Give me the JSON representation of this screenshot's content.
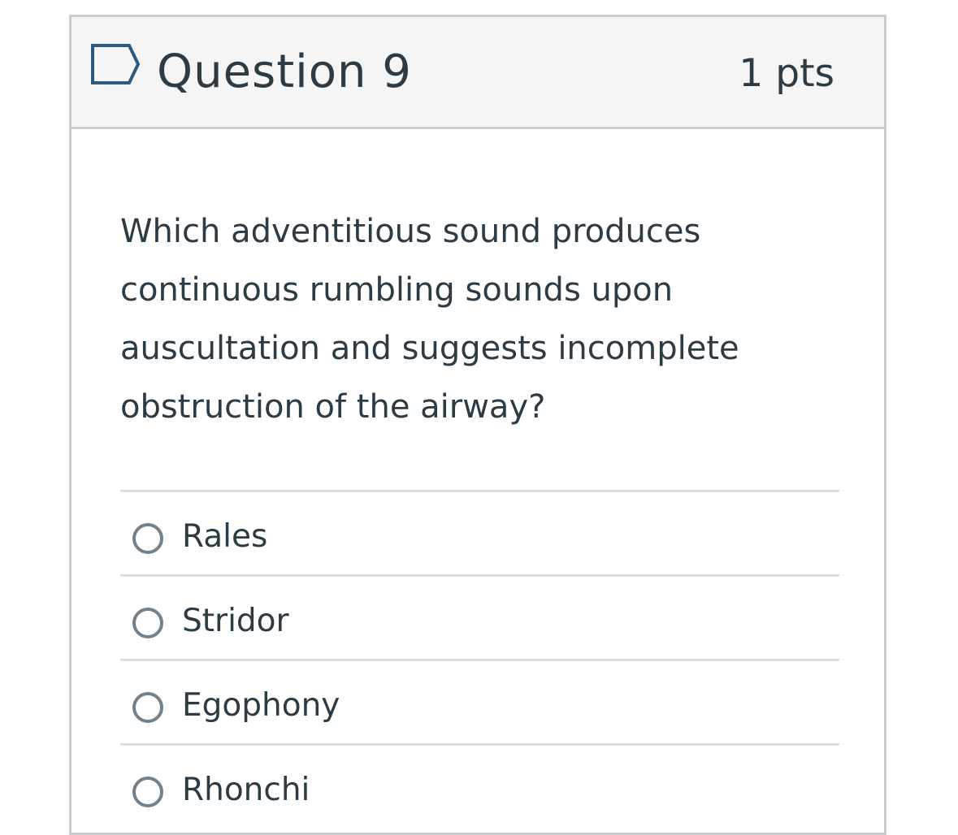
{
  "question": {
    "title": "Question 9",
    "points": "1 pts",
    "flag_icon": "flag-question-icon",
    "text": "Which adventitious sound produces continuous rumbling sounds upon auscultation and suggests incomplete obstruction of the airway?"
  },
  "answers": [
    {
      "label": "Rales"
    },
    {
      "label": "Stridor"
    },
    {
      "label": "Egophony"
    },
    {
      "label": "Rhonchi"
    }
  ],
  "colors": {
    "text": "#2d3b45",
    "header_bg": "#f5f5f5",
    "border": "#c7cdd1",
    "flag": "#2d5b80"
  }
}
